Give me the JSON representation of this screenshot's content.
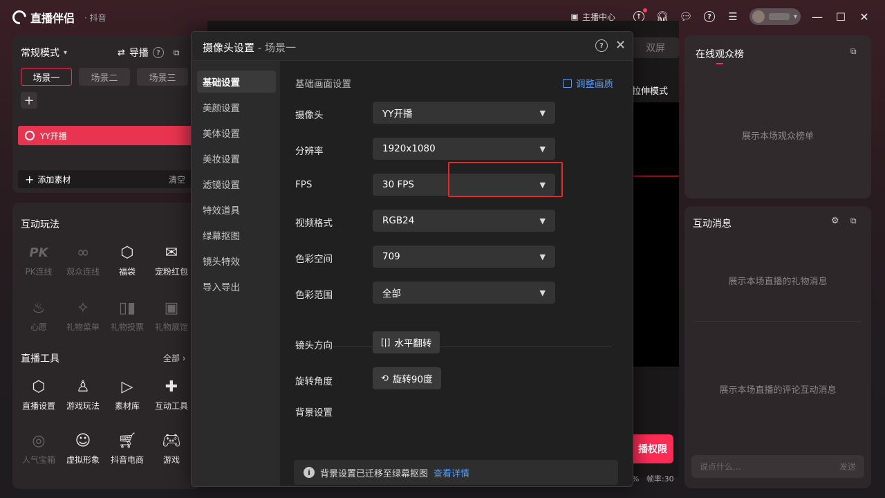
{
  "app": {
    "name": "直播伴侣",
    "platform": "· 抖音"
  },
  "titlebar": {
    "host_center": "主播中心"
  },
  "scenes_panel": {
    "mode": "常规模式",
    "guide": "导播",
    "scenes": [
      "场景一",
      "场景二",
      "场景三"
    ],
    "source_item": "YY开播",
    "add_material": "添加素材",
    "clear": "清空"
  },
  "interactive": {
    "title": "互动玩法",
    "items": [
      {
        "label": "PK连线",
        "icon": "pk-icon",
        "enabled": false
      },
      {
        "label": "观众连线",
        "icon": "audience-link-icon",
        "enabled": false
      },
      {
        "label": "福袋",
        "icon": "lucky-bag-icon",
        "enabled": true
      },
      {
        "label": "宠粉红包",
        "icon": "red-packet-icon",
        "enabled": true
      },
      {
        "label": "心愿",
        "icon": "wish-icon",
        "enabled": false
      },
      {
        "label": "礼物菜单",
        "icon": "gift-menu-icon",
        "enabled": false
      },
      {
        "label": "礼物投票",
        "icon": "gift-vote-icon",
        "enabled": false
      },
      {
        "label": "礼物展馆",
        "icon": "gift-hall-icon",
        "enabled": false
      }
    ]
  },
  "tools": {
    "title": "直播工具",
    "all": "全部",
    "items": [
      {
        "label": "直播设置",
        "icon": "live-settings-icon",
        "enabled": true
      },
      {
        "label": "游戏玩法",
        "icon": "game-play-icon",
        "enabled": true
      },
      {
        "label": "素材库",
        "icon": "material-library-icon",
        "enabled": true
      },
      {
        "label": "互动工具",
        "icon": "interactive-tools-icon",
        "enabled": true
      },
      {
        "label": "人气宝箱",
        "icon": "popularity-box-icon",
        "enabled": false
      },
      {
        "label": "虚拟形象",
        "icon": "avatar-icon",
        "enabled": true
      },
      {
        "label": "抖音电商",
        "icon": "shopping-cart-icon",
        "enabled": true
      },
      {
        "label": "游戏",
        "icon": "gamepad-icon",
        "enabled": true
      }
    ]
  },
  "preview": {
    "dual_screen": "双屏",
    "stretch_mode": "拉伸模式",
    "live_permission": "播权限",
    "fps": "帧率:30"
  },
  "right": {
    "ranking_title": "在线观众榜",
    "ranking_placeholder": "展示本场观众榜单",
    "messages_title": "互动消息",
    "gift_placeholder": "展示本场直播的礼物消息",
    "comment_placeholder": "展示本场直播的评论互动消息",
    "input_placeholder": "说点什么...",
    "send": "发送"
  },
  "dialog": {
    "title": "摄像头设置",
    "scene": " - 场景一",
    "nav": [
      "基础设置",
      "美颜设置",
      "美体设置",
      "美妆设置",
      "滤镜设置",
      "特效道具",
      "绿幕抠图",
      "镜头特效",
      "导入导出"
    ],
    "section_title": "基础画面设置",
    "adjust_quality": "调整画质",
    "fields": [
      {
        "label": "摄像头",
        "value": "YY开播"
      },
      {
        "label": "分辨率",
        "value": "1920x1080"
      },
      {
        "label": "FPS",
        "value": "30 FPS"
      },
      {
        "label": "视频格式",
        "value": "RGB24"
      },
      {
        "label": "色彩空间",
        "value": "709"
      },
      {
        "label": "色彩范围",
        "value": "全部"
      }
    ],
    "lens_direction_label": "镜头方向",
    "flip_button": "水平翻转",
    "rotate_label": "旋转角度",
    "rotate_button": "旋转90度",
    "background_label": "背景设置",
    "info_text": "背景设置已迁移至绿幕抠图",
    "info_link": "查看详情"
  },
  "colors": {
    "accent": "#fe2c55",
    "link": "#5b9bf0",
    "highlight_box": "#e52a2a"
  }
}
